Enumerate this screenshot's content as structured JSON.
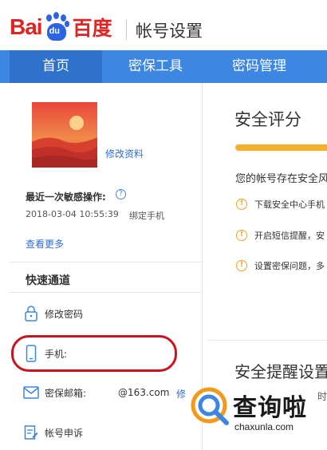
{
  "header": {
    "logo_latin": "Bai",
    "logo_paw_text": "du",
    "logo_cn": "百度",
    "title": "帐号设置"
  },
  "nav": {
    "tabs": [
      {
        "label": "首页",
        "active": true
      },
      {
        "label": "密保工具",
        "active": false
      },
      {
        "label": "密码管理",
        "active": false
      }
    ]
  },
  "profile": {
    "edit_label": "修改资料"
  },
  "recent": {
    "label": "最近一次敏感操作:",
    "help": "?",
    "time": "2018-03-04 10:55:39",
    "operation": "绑定手机",
    "view_more": "查看更多"
  },
  "quick": {
    "title": "快速通道",
    "items": [
      {
        "label": "修改密码",
        "icon": "lock-icon"
      },
      {
        "label": "手机:",
        "icon": "phone-icon"
      },
      {
        "label": "密保邮箱:",
        "value": "@163.com",
        "icon": "mail-icon"
      },
      {
        "label": "帐号申诉",
        "icon": "appeal-icon"
      }
    ],
    "edit": "修"
  },
  "security": {
    "title": "安全评分",
    "desc": "您的帐号存在安全风",
    "tips": [
      "下载安全中心手机",
      "开启短信提醒，安",
      "设置密保问题，多"
    ],
    "remind_title": "安全提醒设置",
    "remind_tail": "时"
  },
  "watermark": {
    "text": "查询啦",
    "url": "chaxunla.com"
  },
  "colors": {
    "brand_red": "#e02323",
    "brand_blue": "#2b63e0",
    "nav_blue": "#3d86e1",
    "score_orange": "#f5b12c",
    "annotation_red": "#c8141e"
  }
}
